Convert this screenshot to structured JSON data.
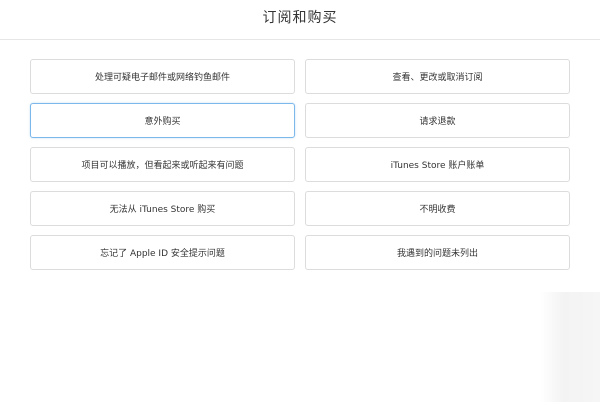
{
  "header": {
    "title": "订阅和购买"
  },
  "options": [
    {
      "label": "处理可疑电子邮件或网络钓鱼邮件"
    },
    {
      "label": "查看、更改或取消订阅"
    },
    {
      "label": "意外购买"
    },
    {
      "label": "请求退款"
    },
    {
      "label": "项目可以播放，但看起来或听起来有问题"
    },
    {
      "label": "iTunes Store 账户账单"
    },
    {
      "label": "无法从 iTunes Store 购买"
    },
    {
      "label": "不明收费"
    },
    {
      "label": "忘记了 Apple ID 安全提示问题"
    },
    {
      "label": "我遇到的问题未列出"
    }
  ],
  "selected_option_index": 2,
  "colors": {
    "border": "#dcdcdc",
    "selected_border": "#7cb8ea",
    "text": "#333333",
    "divider": "#e6e6e6"
  }
}
